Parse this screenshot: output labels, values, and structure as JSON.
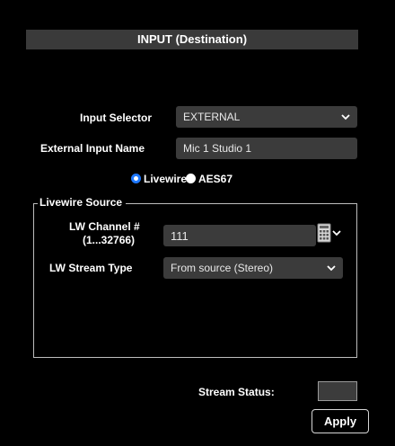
{
  "header": {
    "title": "INPUT (Destination)"
  },
  "input_selector": {
    "label": "Input Selector",
    "value": "EXTERNAL"
  },
  "external_input_name": {
    "label": "External Input Name",
    "value": "Mic 1 Studio 1"
  },
  "mode": {
    "options": [
      {
        "label": "Livewire",
        "selected": true
      },
      {
        "label": "AES67",
        "selected": false
      }
    ]
  },
  "livewire_source": {
    "legend": "Livewire Source",
    "channel": {
      "label_line1": "LW Channel #",
      "label_line2": "(1...32766)",
      "value": "111"
    },
    "stream_type": {
      "label": "LW Stream Type",
      "value": "From source (Stereo)"
    }
  },
  "stream_status": {
    "label": "Stream Status:"
  },
  "apply_label": "Apply",
  "colors": {
    "accent": "#1e78ff",
    "field_bg": "#3b3b3b",
    "header_bg": "#3a3a3a"
  },
  "icons": {
    "dropdown": "chevron-down-icon",
    "keypad": "keypad-icon"
  }
}
